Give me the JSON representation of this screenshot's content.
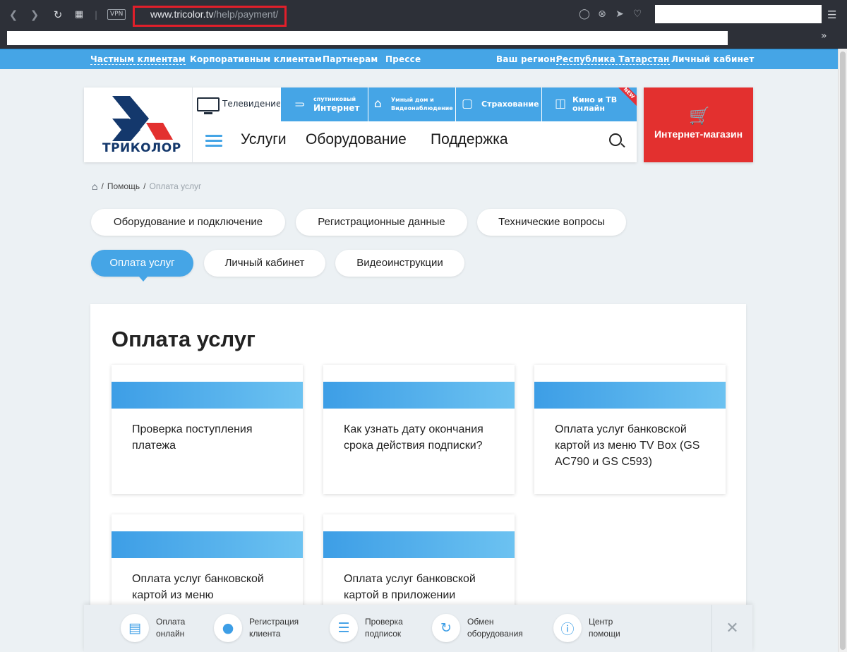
{
  "browser": {
    "url_host": "www.tricolor.tv",
    "url_path": "/help/payment/",
    "vpn_label": "VPN",
    "icons": [
      "back-icon",
      "forward-icon",
      "reload-icon",
      "speed-dial-icon",
      "camera-icon",
      "shield-icon",
      "send-icon",
      "heart-icon",
      "menu-icon",
      "more-icon"
    ]
  },
  "top_nav": {
    "private": "Частным клиентам",
    "corporate": "Корпоративным клиентам",
    "partners": "Партнерам",
    "press": "Прессе",
    "region_label": "Ваш регион:",
    "region_value": "Республика Татарстан",
    "account": "Личный кабинет"
  },
  "header": {
    "logo_text": "ТРИКОЛОР",
    "tabs": {
      "tv": "Телевидение",
      "internet_small": "спутниковый",
      "internet": "Интернет",
      "smart_home_1": "Умный дом и",
      "smart_home_2": "Видеонаблюдение",
      "insurance": "Страхование",
      "cinema_1": "Кино и ТВ",
      "cinema_2": "онлайн",
      "new_badge": "NEW"
    },
    "menu": {
      "services": "Услуги",
      "equipment": "Оборудование",
      "support": "Поддержка"
    },
    "shop": "Интернет-магазин"
  },
  "breadcrumb": {
    "help": "Помощь",
    "current": "Оплата услуг",
    "sep": "/"
  },
  "categories": [
    {
      "label": "Оборудование и подключение"
    },
    {
      "label": "Регистрационные данные"
    },
    {
      "label": "Технические вопросы"
    },
    {
      "label": "Оплата услуг",
      "active": true
    },
    {
      "label": "Личный кабинет"
    },
    {
      "label": "Видеоинструкции"
    }
  ],
  "panel": {
    "title": "Оплата услуг",
    "cards": [
      {
        "title": "Проверка поступления платежа"
      },
      {
        "title": "Как узнать дату окончания срока действия подписки?"
      },
      {
        "title": "Оплата услуг банковской картой из меню TV Box (GS AC790 и GS C593)"
      },
      {
        "title": "Оплата услуг банковской картой из меню"
      },
      {
        "title": "Оплата услуг банковской картой в приложении"
      }
    ]
  },
  "quick_actions": [
    {
      "l1": "Оплата",
      "l2": "онлайн",
      "icon": "wallet-icon"
    },
    {
      "l1": "Регистрация",
      "l2": "клиента",
      "icon": "user-icon"
    },
    {
      "l1": "Проверка",
      "l2": "подписок",
      "icon": "list-icon"
    },
    {
      "l1": "Обмен",
      "l2": "оборудования",
      "icon": "exchange-icon"
    },
    {
      "l1": "Центр",
      "l2": "помощи",
      "icon": "info-icon"
    }
  ],
  "colors": {
    "accent": "#45a5e6",
    "shop": "#e3302f",
    "url_highlight": "#e01f2a",
    "logo_blue": "#14386c"
  }
}
